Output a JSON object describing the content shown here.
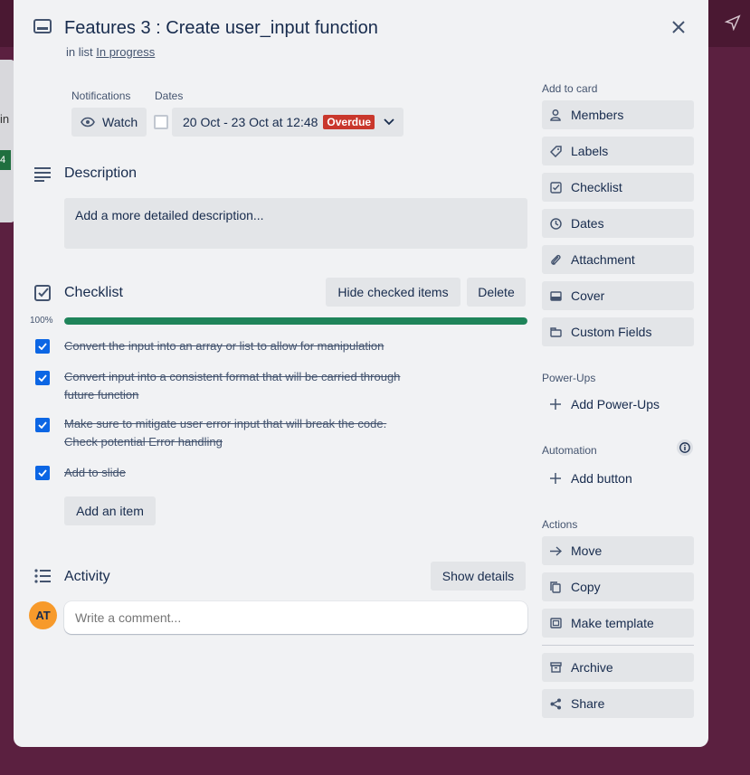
{
  "background": {
    "list_fragment_text": "in",
    "badge_text": "4"
  },
  "card": {
    "title": "Features 3 : Create user_input function",
    "in_list_prefix": "in list",
    "list_name": "In progress"
  },
  "notifications": {
    "label": "Notifications",
    "watch_label": "Watch"
  },
  "dates": {
    "label": "Dates",
    "value": "20 Oct - 23 Oct at 12:48",
    "status": "Overdue"
  },
  "description": {
    "title": "Description",
    "placeholder": "Add a more detailed description..."
  },
  "checklist": {
    "title": "Checklist",
    "hide_checked_label": "Hide checked items",
    "delete_label": "Delete",
    "progress_text": "100%",
    "progress": 1.0,
    "items": [
      {
        "line1": "Convert the input into an array or list to allow for manipulation",
        "line2": "",
        "checked": true
      },
      {
        "line1": "Convert input into a consistent format that will be carried through",
        "line2": "future function",
        "checked": true
      },
      {
        "line1": "Make sure to mitigate user error input that will break the code.",
        "line2": "Check potential Error handling",
        "checked": true
      },
      {
        "line1": "Add to slide",
        "line2": "",
        "checked": true
      }
    ],
    "add_item_label": "Add an item"
  },
  "activity": {
    "title": "Activity",
    "show_details_label": "Show details",
    "comment_placeholder": "Write a comment...",
    "avatar_initials": "AT"
  },
  "sidebar": {
    "add_to_card_label": "Add to card",
    "add_to_card": [
      {
        "label": "Members",
        "icon": "person-icon"
      },
      {
        "label": "Labels",
        "icon": "tag-icon"
      },
      {
        "label": "Checklist",
        "icon": "checklist-icon"
      },
      {
        "label": "Dates",
        "icon": "clock-icon"
      },
      {
        "label": "Attachment",
        "icon": "paperclip-icon"
      },
      {
        "label": "Cover",
        "icon": "cover-icon"
      },
      {
        "label": "Custom Fields",
        "icon": "custom-fields-icon"
      }
    ],
    "powerups_label": "Power-Ups",
    "add_powerups_label": "Add Power-Ups",
    "automation_label": "Automation",
    "add_button_label": "Add button",
    "actions_label": "Actions",
    "actions": [
      {
        "label": "Move",
        "icon": "arrow-right-icon"
      },
      {
        "label": "Copy",
        "icon": "copy-icon"
      },
      {
        "label": "Make template",
        "icon": "template-icon"
      }
    ],
    "archive_label": "Archive",
    "share_label": "Share"
  },
  "colors": {
    "accent": "#0c66e4",
    "progress": "#1f845a",
    "overdue": "#c9372c",
    "avatar": "#f79a2b"
  }
}
